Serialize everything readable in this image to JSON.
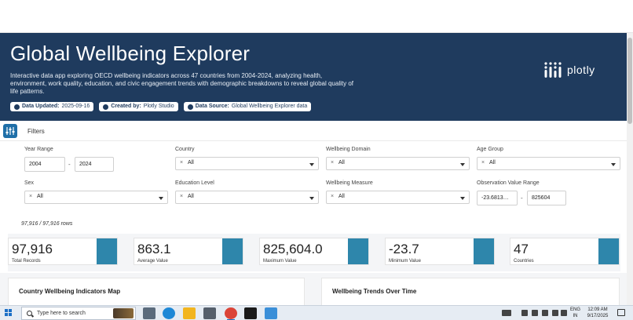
{
  "header": {
    "title": "Global Wellbeing Explorer",
    "description": "Interactive data app exploring OECD wellbeing indicators across 47 countries from 2004-2024, analyzing health, environment, work quality, education, and civic engagement trends with demographic breakdowns to reveal global quality of life patterns.",
    "badges": [
      {
        "label": "Data Updated:",
        "value": "2025-09-16",
        "icon": "check-circle-icon"
      },
      {
        "label": "Created by:",
        "value": "Plotly Studio",
        "icon": "user-icon"
      },
      {
        "label": "Data Source:",
        "value": "Global Wellbeing Explorer data",
        "icon": "database-icon"
      }
    ],
    "logo_text": "plotly",
    "colors": {
      "header_bg": "#1f3b5e",
      "accent": "#2e86ab"
    }
  },
  "filters": {
    "title": "Filters",
    "icon": "sliders-icon",
    "year_range": {
      "label": "Year Range",
      "from": "2004",
      "to": "2024",
      "separator": "-"
    },
    "country": {
      "label": "Country",
      "value": "All"
    },
    "domain": {
      "label": "Wellbeing Domain",
      "value": "All"
    },
    "age_group": {
      "label": "Age Group",
      "value": "All"
    },
    "sex": {
      "label": "Sex",
      "value": "All"
    },
    "education": {
      "label": "Education Level",
      "value": "All"
    },
    "measure": {
      "label": "Wellbeing Measure",
      "value": "All"
    },
    "obs_range": {
      "label": "Observation Value Range",
      "from": "-23.6813…",
      "to": "825604",
      "separator": "-"
    },
    "clear_glyph": "×"
  },
  "summary": {
    "rows": "97,916 / 97,916 rows",
    "kpis": [
      {
        "value": "97,916",
        "label": "Total Records"
      },
      {
        "value": "863.1",
        "label": "Average Value"
      },
      {
        "value": "825,604.0",
        "label": "Maximum Value"
      },
      {
        "value": "-23.7",
        "label": "Minimum Value"
      },
      {
        "value": "47",
        "label": "Countries"
      }
    ]
  },
  "panels": {
    "map_title": "Country Wellbeing Indicators Map",
    "trends_title": "Wellbeing Trends Over Time"
  },
  "taskbar": {
    "search_placeholder": "Type here to search",
    "lang_line1": "ENG",
    "lang_line2": "IN",
    "time": "12:09 AM",
    "date": "9/17/2025"
  }
}
